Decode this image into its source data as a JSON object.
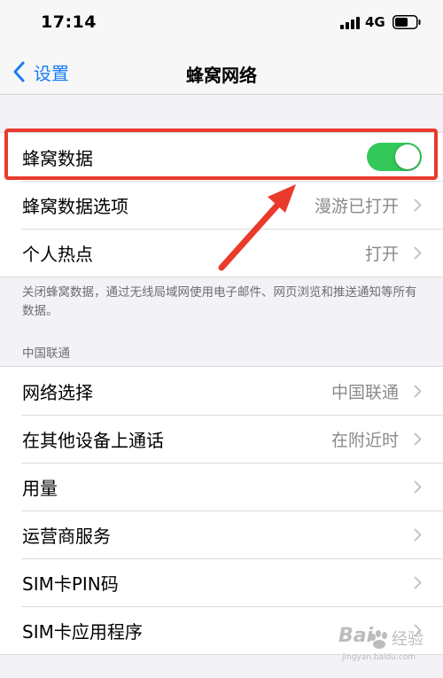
{
  "status_bar": {
    "time": "17:14",
    "network": "4G"
  },
  "nav": {
    "back_label": "设置",
    "title": "蜂窝网络"
  },
  "group1": [
    {
      "label": "蜂窝数据",
      "toggle_on": true
    },
    {
      "label": "蜂窝数据选项",
      "value": "漫游已打开"
    },
    {
      "label": "个人热点",
      "value": "打开"
    }
  ],
  "footnote": "关闭蜂窝数据，通过无线局域网使用电子邮件、网页浏览和推送通知等所有数据。",
  "section_header": "中国联通",
  "group2": [
    {
      "label": "网络选择",
      "value": "中国联通"
    },
    {
      "label": "在其他设备上通话",
      "value": "在附近时"
    },
    {
      "label": "用量",
      "value": ""
    },
    {
      "label": "运营商服务",
      "value": ""
    },
    {
      "label": "SIM卡PIN码",
      "value": ""
    },
    {
      "label": "SIM卡应用程序",
      "value": ""
    }
  ],
  "watermark": {
    "logo_left": "Bai",
    "logo_right": "经验",
    "url": "jingyan.baidu.com"
  },
  "colors": {
    "accent_blue": "#1a7cf5",
    "toggle_green": "#34c759",
    "annotation_red": "#ea3a2b"
  }
}
